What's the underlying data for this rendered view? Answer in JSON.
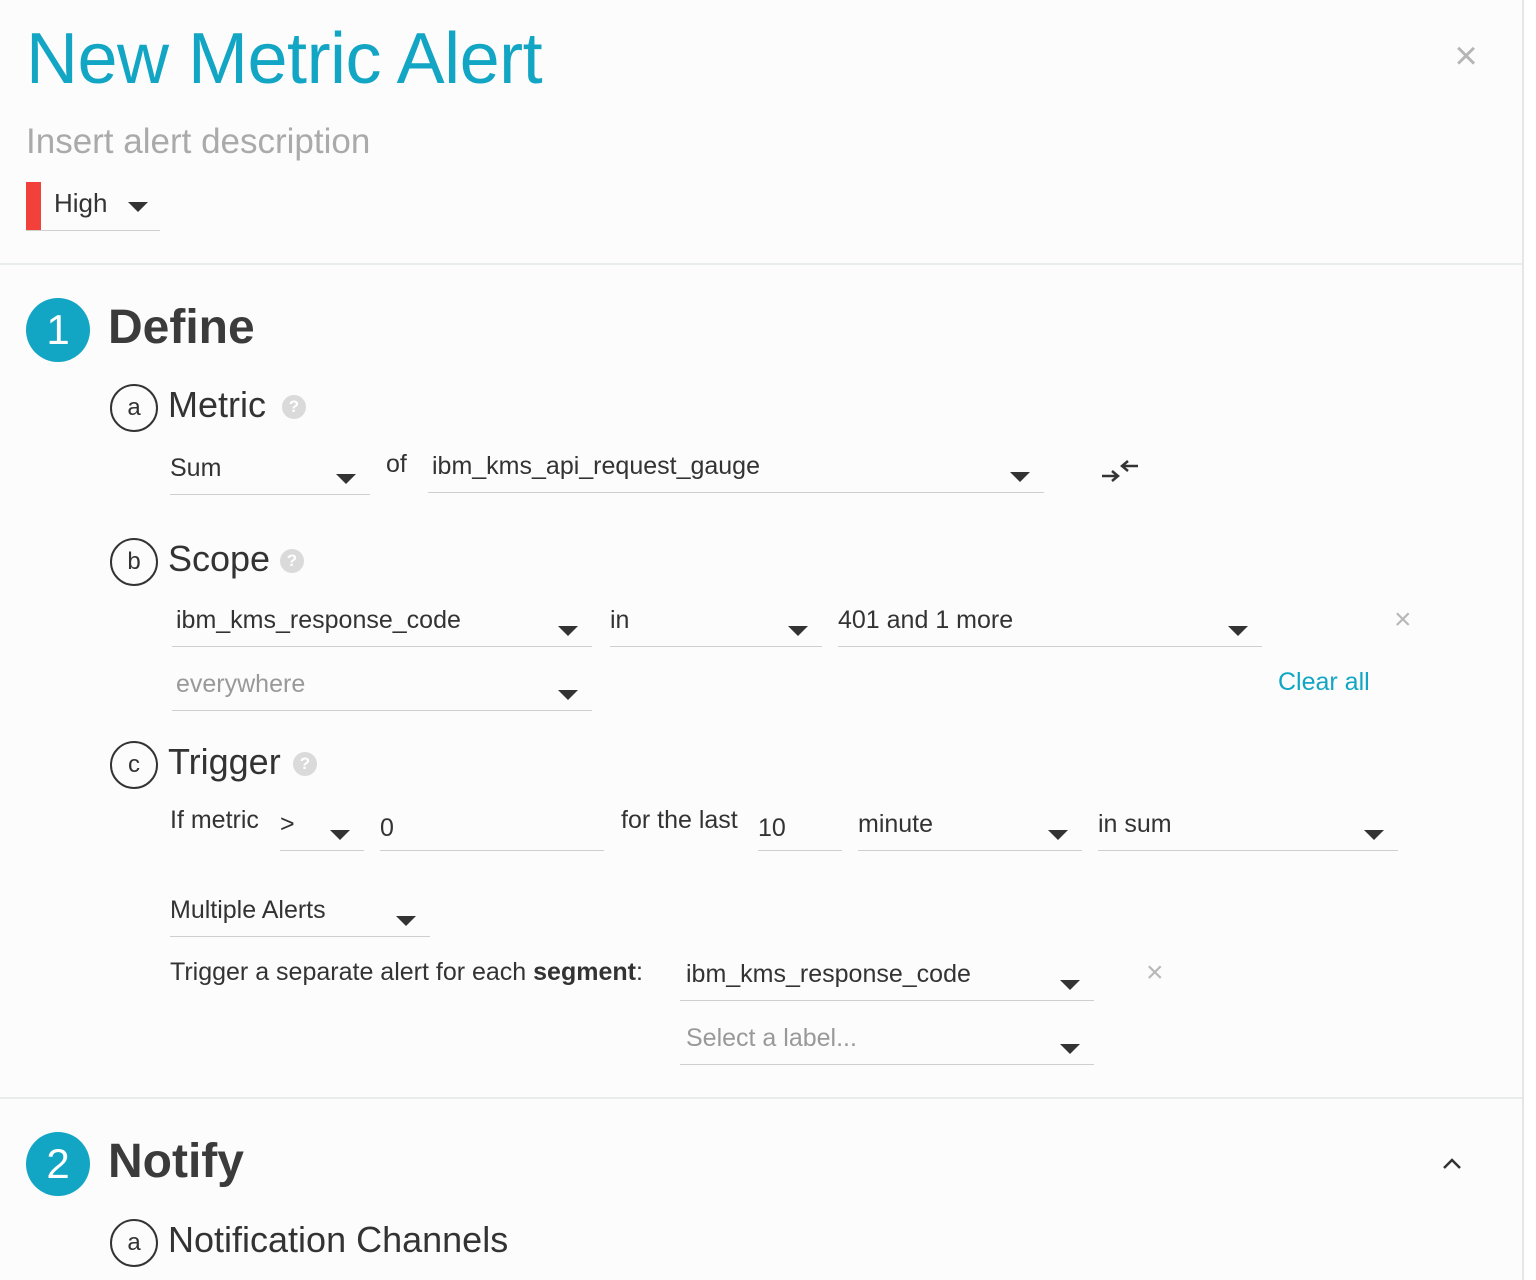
{
  "header": {
    "title": "New Metric Alert",
    "description_placeholder": "Insert alert description",
    "severity": {
      "label": "High",
      "color": "#f2403a"
    },
    "close_icon": "×"
  },
  "define": {
    "number": "1",
    "title": "Define",
    "metric": {
      "letter": "a",
      "title": "Metric",
      "help": "?",
      "aggregation": "Sum",
      "of_label": "of",
      "metric_name": "ibm_kms_api_request_gauge"
    },
    "scope": {
      "letter": "b",
      "title": "Scope",
      "help": "?",
      "label": "ibm_kms_response_code",
      "operator": "in",
      "values": "401 and 1 more",
      "location_placeholder": "everywhere",
      "clear_all": "Clear all"
    },
    "trigger": {
      "letter": "c",
      "title": "Trigger",
      "help": "?",
      "if_metric_label": "If metric",
      "comparator": ">",
      "threshold": "0",
      "for_the_last_label": "for the last",
      "duration": "10",
      "unit": "minute",
      "aggregation": "in sum",
      "alert_mode": "Multiple Alerts",
      "segment_text_prefix": "Trigger a separate alert for each ",
      "segment_text_bold": "segment",
      "segment_text_suffix": ":",
      "segment_label": "ibm_kms_response_code",
      "segment_placeholder": "Select a label..."
    }
  },
  "notify": {
    "number": "2",
    "title": "Notify",
    "collapse_icon": "^",
    "channels": {
      "letter": "a",
      "title": "Notification Channels"
    }
  },
  "colors": {
    "accent": "#12a6c4",
    "severity_high": "#f2403a"
  }
}
